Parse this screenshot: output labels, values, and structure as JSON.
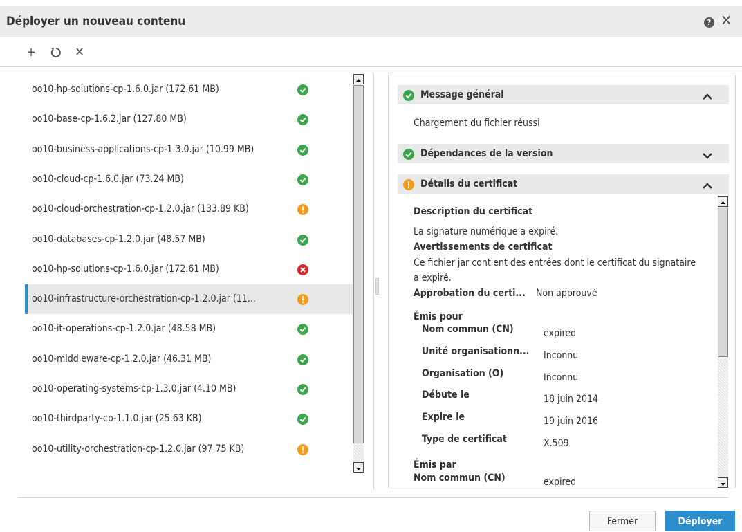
{
  "dialog": {
    "title": "Déployer un nouveau contenu",
    "help_icon": "?",
    "close_icon": "✕"
  },
  "toolbar": {
    "add_icon": "+",
    "refresh_icon": "⟳",
    "remove_icon": "✕"
  },
  "files": [
    {
      "name": "oo10-hp-solutions-cp-1.6.0.jar (172.61 MB)",
      "status": "success"
    },
    {
      "name": "oo10-base-cp-1.6.2.jar (127.80 MB)",
      "status": "success"
    },
    {
      "name": "oo10-business-applications-cp-1.3.0.jar (10.99 MB)",
      "status": "success"
    },
    {
      "name": "oo10-cloud-cp-1.6.0.jar (73.24 MB)",
      "status": "success"
    },
    {
      "name": "oo10-cloud-orchestration-cp-1.2.0.jar (133.89 KB)",
      "status": "warning"
    },
    {
      "name": "oo10-databases-cp-1.2.0.jar (48.57 MB)",
      "status": "success"
    },
    {
      "name": "oo10-hp-solutions-cp-1.6.0.jar (172.61 MB)",
      "status": "error"
    },
    {
      "name": "oo10-infrastructure-orchestration-cp-1.2.0.jar (11...",
      "status": "warning",
      "selected": true
    },
    {
      "name": "oo10-it-operations-cp-1.2.0.jar (48.58 MB)",
      "status": "success"
    },
    {
      "name": "oo10-middleware-cp-1.2.0.jar (46.31 MB)",
      "status": "success"
    },
    {
      "name": "oo10-operating-systems-cp-1.3.0.jar (4.10 MB)",
      "status": "success"
    },
    {
      "name": "oo10-thirdparty-cp-1.1.0.jar (25.63 KB)",
      "status": "success"
    },
    {
      "name": "oo10-utility-orchestration-cp-1.2.0.jar (97.75 KB)",
      "status": "warning"
    }
  ],
  "details": {
    "general": {
      "title": "Message général",
      "status": "success",
      "message": "Chargement du fichier réussi"
    },
    "dependencies": {
      "title": "Dépendances de la version",
      "status": "success"
    },
    "certificate": {
      "title": "Détails du certificat",
      "status": "warning",
      "description_label": "Description du certificat",
      "description_text": "La signature numérique a expiré.",
      "warnings_label": "Avertissements de certificat",
      "warnings_text_line1": "Ce fichier jar contient des entrées dont le certificat du signataire",
      "warnings_text_line2": "a expiré.",
      "approval_label": "Approbation du certi...",
      "approval_value": "Non approuvé",
      "issued_to_label": "Émis pour",
      "issued_to": [
        {
          "label": "Nom commun (CN)",
          "value": "expired"
        },
        {
          "label": "Unité organisationn...",
          "value": "Inconnu"
        },
        {
          "label": "Organisation (O)",
          "value": "Inconnu"
        },
        {
          "label": "Débute le",
          "value": "18 juin 2014"
        },
        {
          "label": "Expire le",
          "value": "19 juin 2016"
        },
        {
          "label": "Type de certificat",
          "value": "X.509"
        }
      ],
      "issued_by_label": "Émis par",
      "issued_by": [
        {
          "label": "Nom commun (CN)",
          "value": "expired"
        }
      ]
    }
  },
  "buttons": {
    "close": "Fermer",
    "deploy": "Déployer"
  },
  "colors": {
    "success": "#3aa54a",
    "warning": "#f29b1d",
    "error": "#d8262a",
    "accent": "#2c8dcc"
  }
}
